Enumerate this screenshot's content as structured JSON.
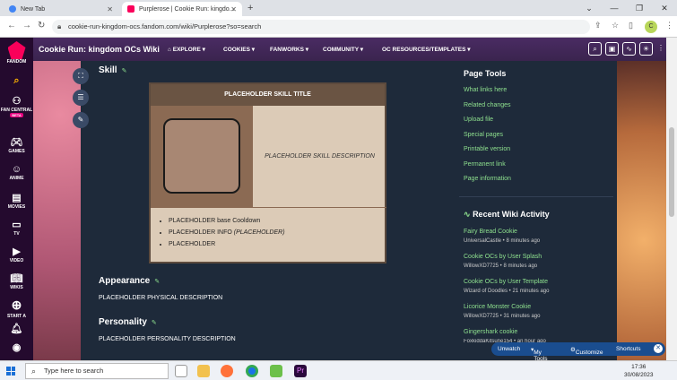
{
  "browser": {
    "tabs": [
      {
        "title": "New Tab"
      },
      {
        "title": "Purplerose | Cookie Run: kingdo..."
      }
    ],
    "url": "cookie-run-kingdom-ocs.fandom.com/wiki/Purplerose?so=search",
    "profile_initial": "C"
  },
  "rail": {
    "items": [
      {
        "label": "FANDOM",
        "icon": "fandom-logo"
      },
      {
        "label": "",
        "icon": "search-icon"
      },
      {
        "label": "FAN CENTRAL",
        "icon": "fan-central-icon",
        "badge": "BETA"
      },
      {
        "label": "GAMES",
        "icon": "games-icon"
      },
      {
        "label": "ANIME",
        "icon": "anime-icon"
      },
      {
        "label": "MOVIES",
        "icon": "movies-icon"
      },
      {
        "label": "TV",
        "icon": "tv-icon"
      },
      {
        "label": "VIDEO",
        "icon": "video-icon"
      },
      {
        "label": "WIKIS",
        "icon": "wikis-icon"
      },
      {
        "label": "START A",
        "icon": "plus-icon"
      }
    ]
  },
  "wiki": {
    "name": "Cookie Run: kingdom OCs Wiki",
    "nav": [
      "EXPLORE",
      "COOKIES",
      "FANWORKS",
      "COMMUNITY",
      "OC RESOURCES/TEMPLATES"
    ]
  },
  "article": {
    "skill_heading": "Skill",
    "skill_title": "PLACEHOLDER SKILL TITLE",
    "skill_description": "PLACEHOLDER SKILL DESCRIPTION",
    "skill_list": [
      "PLACEHOLDER base Cooldown",
      "PLACEHOLDER INFO",
      "PLACEHOLDER"
    ],
    "skill_list_italic": "(PLACEHOLDER)",
    "appearance_heading": "Appearance",
    "appearance_text": "PLACEHOLDER PHYSICAL DESCRIPTION",
    "personality_heading": "Personality",
    "personality_text": "PLACEHOLDER PERSONALITY DESCRIPTION"
  },
  "page_tools": {
    "title": "Page Tools",
    "links": [
      "What links here",
      "Related changes",
      "Upload file",
      "Special pages",
      "Printable version",
      "Permanent link",
      "Page information"
    ]
  },
  "recent_activity": {
    "title": "Recent Wiki Activity",
    "items": [
      {
        "page": "Fairy Bread Cookie",
        "meta": "UniversalCastle • 8 minutes ago"
      },
      {
        "page": "Cookie OCs by User Splash",
        "meta": "WillowXD7725 • 8 minutes ago"
      },
      {
        "page": "Cookie OCs by User Template",
        "meta": "Wizard of Doodles • 21 minutes ago"
      },
      {
        "page": "Licorice Monster Cookie",
        "meta": "WillowXD7725 • 31 minutes ago"
      },
      {
        "page": "Gingershark cookie",
        "meta": "FoxkiddaKitsune154 • an hour ago"
      }
    ]
  },
  "toolbar_pill": {
    "unwatch": "Unwatch",
    "my_tools": "My Tools",
    "customize": "Customize",
    "shortcuts": "Shortcuts"
  },
  "taskbar": {
    "search_placeholder": "Type here to search",
    "time": "17:36",
    "date": "30/08/2023"
  }
}
